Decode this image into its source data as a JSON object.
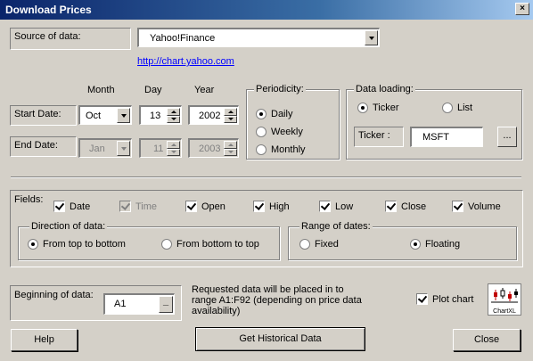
{
  "window": {
    "title": "Download Prices",
    "close_glyph": "×"
  },
  "source": {
    "label": "Source of data:",
    "selected": "Yahoo!Finance",
    "link": "http://chart.yahoo.com"
  },
  "dates": {
    "col_month": "Month",
    "col_day": "Day",
    "col_year": "Year",
    "start_label": "Start Date:",
    "end_label": "End Date:",
    "start_month": "Oct",
    "start_day": "13",
    "start_year": "2002",
    "end_month": "Jan",
    "end_day": "11",
    "end_year": "2003"
  },
  "periodicity": {
    "title": "Periodicity:",
    "options": [
      "Daily",
      "Weekly",
      "Monthly"
    ],
    "selected": "Daily"
  },
  "loading": {
    "title": "Data loading:",
    "opt_ticker": "Ticker",
    "opt_list": "List",
    "selected": "Ticker",
    "ticker_label": "Ticker :",
    "ticker_value": "MSFT",
    "browse_label": "..."
  },
  "fields": {
    "label": "Fields:",
    "items": [
      {
        "name": "Date",
        "checked": true,
        "enabled": true
      },
      {
        "name": "Time",
        "checked": true,
        "enabled": false
      },
      {
        "name": "Open",
        "checked": true,
        "enabled": true
      },
      {
        "name": "High",
        "checked": true,
        "enabled": true
      },
      {
        "name": "Low",
        "checked": true,
        "enabled": true
      },
      {
        "name": "Close",
        "checked": true,
        "enabled": true
      },
      {
        "name": "Volume",
        "checked": true,
        "enabled": true
      }
    ]
  },
  "direction": {
    "title": "Direction of data:",
    "opt_top": "From top to bottom",
    "opt_bottom": "From bottom to top",
    "selected": "From top to bottom"
  },
  "range": {
    "title": "Range of dates:",
    "opt_fixed": "Fixed",
    "opt_floating": "Floating",
    "selected": "Floating"
  },
  "beginning": {
    "label": "Beginning of data:",
    "value": "A1",
    "button": "_"
  },
  "info_text": "Requested data will be placed in to range A1:F92 (depending on price data availability)",
  "plot_chart": {
    "label": "Plot chart",
    "checked": true,
    "icon_text": "ChartXL"
  },
  "buttons": {
    "help": "Help",
    "get": "Get Historical Data",
    "close": "Close"
  }
}
